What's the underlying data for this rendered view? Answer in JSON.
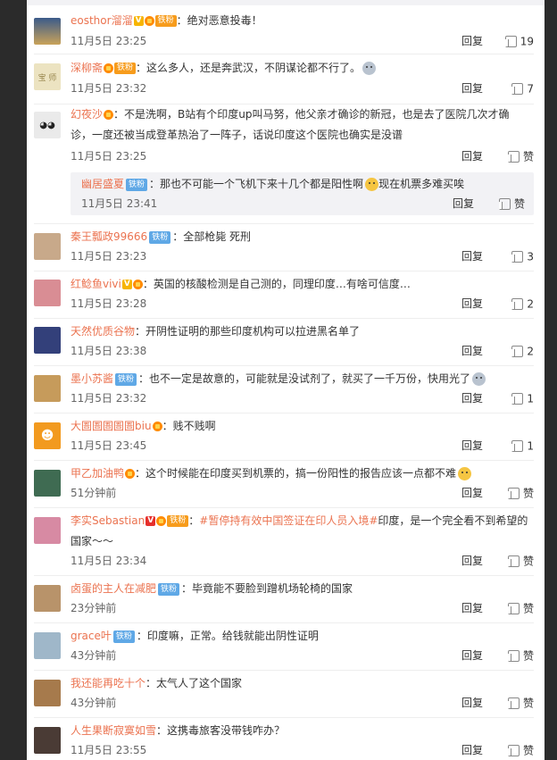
{
  "reply_label": "回复",
  "comments": [
    {
      "name": "eosthor溜溜",
      "text": "绝对恶意投毒！",
      "time": "11月5日 23:25",
      "likes": "19"
    },
    {
      "name": "深柳斋",
      "text": "这么多人，还是奔武汉，不阴谋论都不行了。",
      "time": "11月5日 23:32",
      "likes": "7"
    },
    {
      "name": "幻夜沙",
      "text_line1": "不是洗啊，B站有个印度up叫马努，他父亲才确诊的新冠，也是去了医院几次才确",
      "text_line2": "诊，一度还被当成登革热治了一阵子，话说印度这个医院也确实是没谱",
      "time": "11月5日 23:25",
      "likes": "赞"
    },
    {
      "name": "幽居盛夏",
      "badge": "铁粉",
      "text": "那也不可能一个飞机下来十几个都是阳性啊",
      "text_after": "现在机票多难买唉",
      "time": "11月5日 23:41",
      "likes": "赞"
    },
    {
      "name": "秦王瓢政99666",
      "badge": "铁粉",
      "text": "全部枪毙 死刑",
      "time": "11月5日 23:23",
      "likes": "3"
    },
    {
      "name": "红鲶鱼vivi",
      "text": "英国的核酸检测是自己测的，同理印度…有啥可信度…",
      "time": "11月5日 23:28",
      "likes": "2"
    },
    {
      "name": "天然优质谷物",
      "text": "开阴性证明的那些印度机构可以拉进黑名单了",
      "time": "11月5日 23:38",
      "likes": "2"
    },
    {
      "name": "墨小苏酱",
      "badge": "铁粉",
      "text": "也不一定是故意的，可能就是没试剂了，就买了一千万份，快用光了",
      "time": "11月5日 23:32",
      "likes": "1"
    },
    {
      "name": "大圄圄圄圄圄biu",
      "text": "贱不贱啊",
      "time": "11月5日 23:45",
      "likes": "1"
    },
    {
      "name": "甲乙加油鸭",
      "text": "这个时候能在印度买到机票的，搞一份阳性的报告应该一点都不难",
      "time": "51分钟前",
      "likes": "赞"
    },
    {
      "name": "李实Sebastian",
      "badge_fan": "铁粉",
      "hashtag": "#暂停持有效中国签证在印人员入境#",
      "text": "印度，是一个完全看不到希望的",
      "text_line2": "国家～～",
      "time": "11月5日 23:34",
      "likes": "赞"
    },
    {
      "name": "卤蛋的主人在减肥",
      "badge": "铁粉",
      "text": "毕竟能不要脸到蹭机场轮椅的国家",
      "time": "23分钟前",
      "likes": "赞"
    },
    {
      "name": "grace叶",
      "badge": "铁粉",
      "text": "印度嘛，正常。给钱就能出阴性证明",
      "time": "43分钟前",
      "likes": "赞"
    },
    {
      "name": "我还能再吃十个",
      "text": "太气人了这个国家",
      "time": "43分钟前",
      "likes": "赞"
    },
    {
      "name": "人生果断寂寞如雪",
      "text": "这携毒旅客没带钱咋办？",
      "time": "11月5日 23:55",
      "likes": "赞"
    }
  ],
  "badges": {
    "fan": "铁粉",
    "vip": "V"
  },
  "colors": {
    "name": "#eb7350",
    "link_blue": "#3d7ab8",
    "iron_badge": "#5fa8e6",
    "fan_badge": "#f79c1c"
  }
}
